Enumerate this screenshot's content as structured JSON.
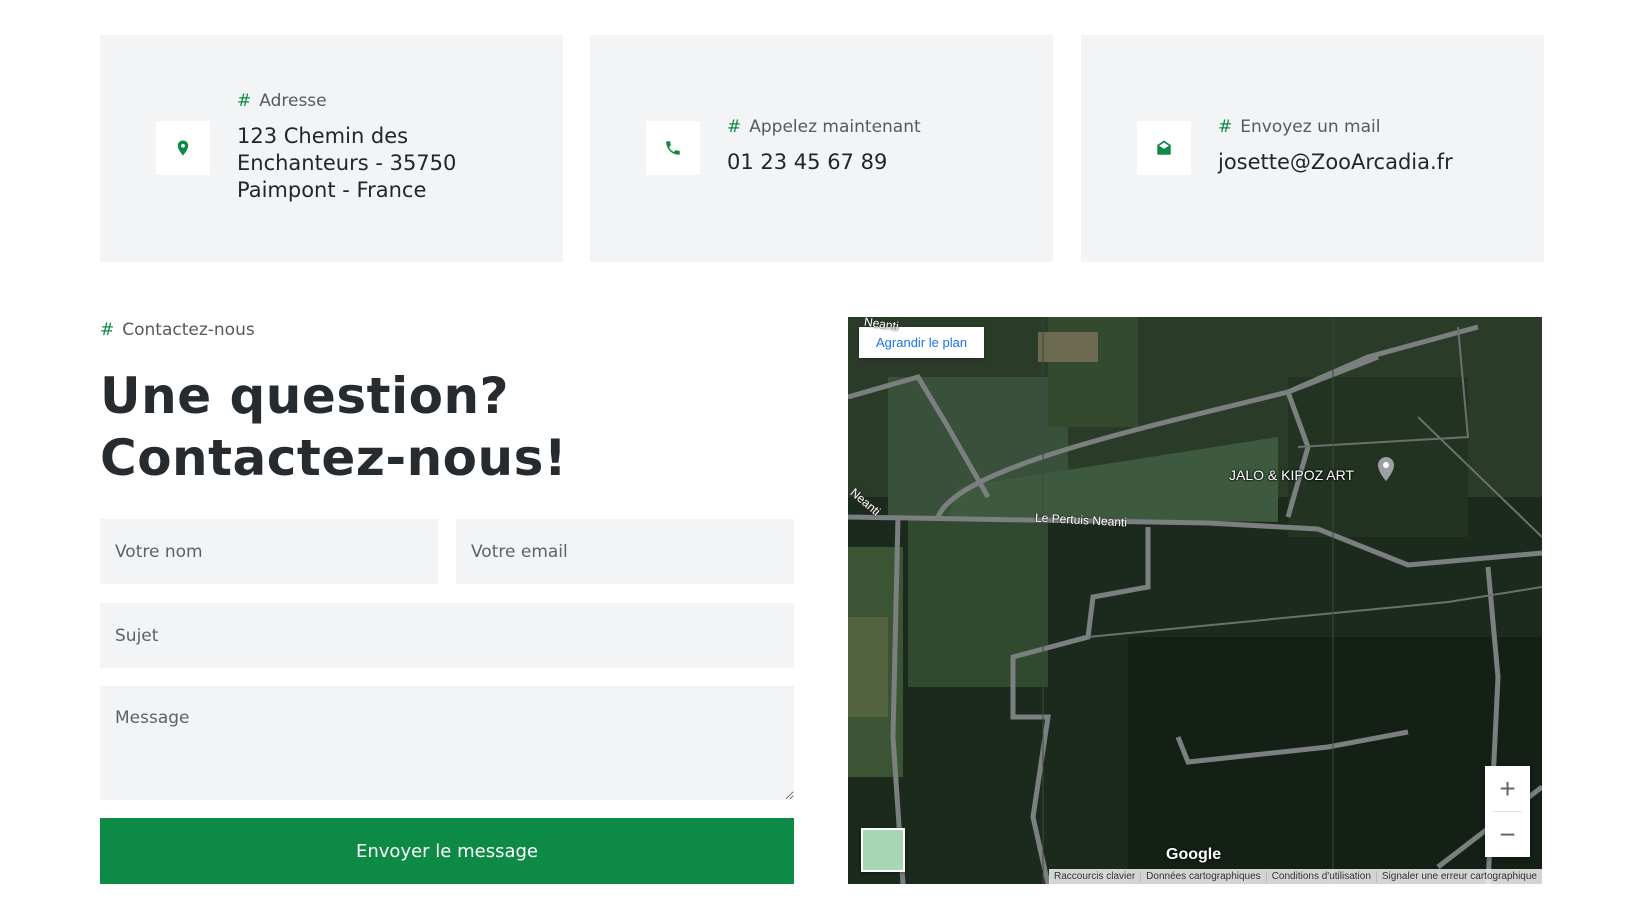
{
  "cards": [
    {
      "label": "Adresse",
      "value": "123 Chemin des Enchanteurs - 35750 Paimpont - France",
      "icon": "map-pin-icon"
    },
    {
      "label": "Appelez maintenant",
      "value": "01 23 45 67 89",
      "icon": "phone-icon"
    },
    {
      "label": "Envoyez un mail",
      "value": "josette@ZooArcadia.fr",
      "icon": "envelope-open-icon"
    }
  ],
  "hash_symbol": "#",
  "contact": {
    "label": "Contactez-nous",
    "title": "Une question? Contactez-nous!",
    "form": {
      "name_placeholder": "Votre nom",
      "email_placeholder": "Votre email",
      "subject_placeholder": "Sujet",
      "message_placeholder": "Message",
      "submit_label": "Envoyer le message"
    }
  },
  "map": {
    "enlarge_label": "Agrandir le plan",
    "poi_label": "JALO & KIPOZ ART",
    "road_main": "Le Pertuis Neanti",
    "road_top": "Neanti",
    "road_left": "Neanti",
    "zoom_in": "+",
    "zoom_out": "−",
    "logo": "Google",
    "attribution": [
      "Raccourcis clavier",
      "Données cartographiques",
      "Conditions d'utilisation",
      "Signaler une erreur cartographique"
    ]
  },
  "colors": {
    "accent": "#0d8a45",
    "card_bg": "#f3f4f5",
    "heading": "#262b2f"
  }
}
